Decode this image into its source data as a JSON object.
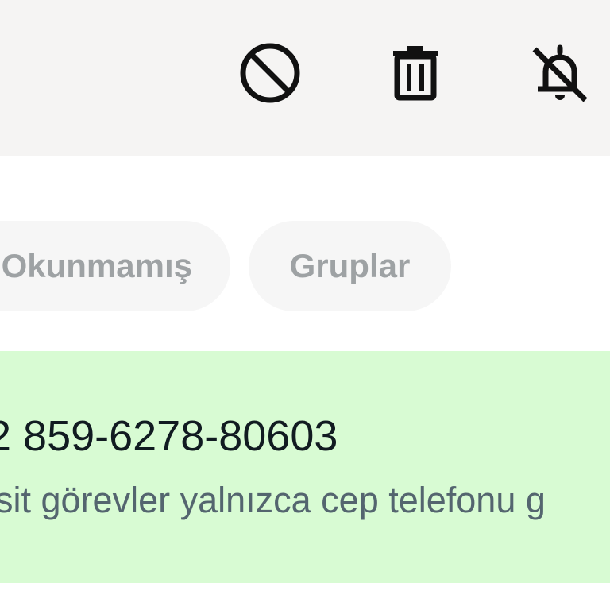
{
  "action_bar": {
    "icons": [
      "block-icon",
      "trash-icon",
      "bell-off-icon"
    ]
  },
  "filters": {
    "unread_label": "Okunmamış",
    "groups_label": "Gruplar"
  },
  "chat": {
    "name": "2 859-6278-80603",
    "preview": "sit görevler yalnızca cep telefonu g"
  },
  "colors": {
    "action_bar_bg": "#f5f4f3",
    "chip_bg": "#f6f6f6",
    "chip_text": "#9ea2a4",
    "selected_row_bg": "#d8fbd3",
    "icon": "#111111"
  }
}
